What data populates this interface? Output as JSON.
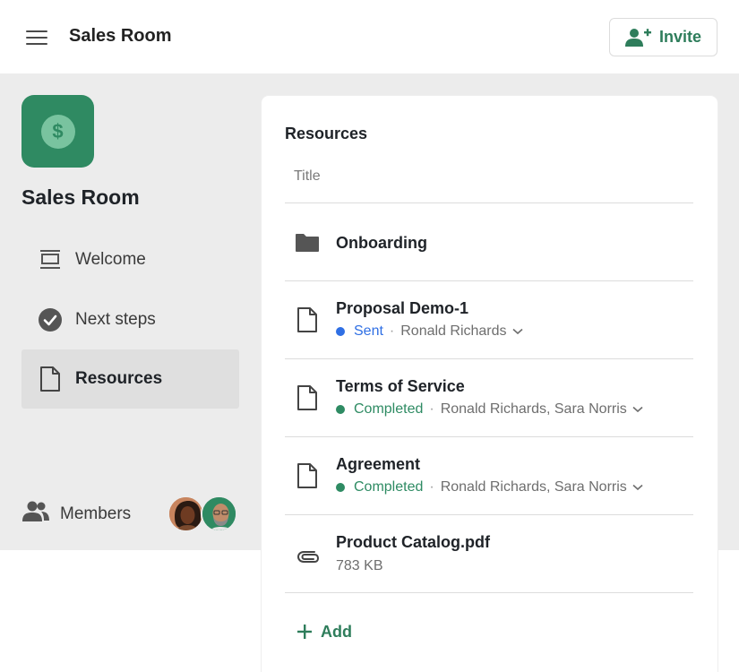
{
  "header": {
    "title": "Sales Room",
    "invite_label": "Invite"
  },
  "sidebar": {
    "logo_symbol": "$",
    "title": "Sales Room",
    "items": [
      {
        "label": "Welcome",
        "icon": "welcome-screen-icon",
        "active": false
      },
      {
        "label": "Next steps",
        "icon": "check-circle-icon",
        "active": false
      },
      {
        "label": "Resources",
        "icon": "document-icon",
        "active": true
      }
    ],
    "members_label": "Members"
  },
  "resources": {
    "heading": "Resources",
    "column_title": "Title",
    "rows": [
      {
        "name": "Onboarding",
        "icon": "folder-icon"
      },
      {
        "name": "Proposal Demo-1",
        "icon": "document-icon",
        "status": "Sent",
        "status_color": "#2f6fe4",
        "people": "Ronald Richards"
      },
      {
        "name": "Terms of Service",
        "icon": "document-icon",
        "status": "Completed",
        "status_color": "#2e8b63",
        "people": "Ronald Richards, Sara Norris"
      },
      {
        "name": "Agreement",
        "icon": "document-icon",
        "status": "Completed",
        "status_color": "#2e8b63",
        "people": "Ronald Richards, Sara Norris"
      },
      {
        "name": "Product Catalog.pdf",
        "icon": "paperclip-icon",
        "size": "783 KB"
      }
    ],
    "add_label": "Add"
  },
  "colors": {
    "accent": "#2e7d5b",
    "brand_tile": "#2f8a62",
    "sidebar_bg": "#ececec"
  }
}
